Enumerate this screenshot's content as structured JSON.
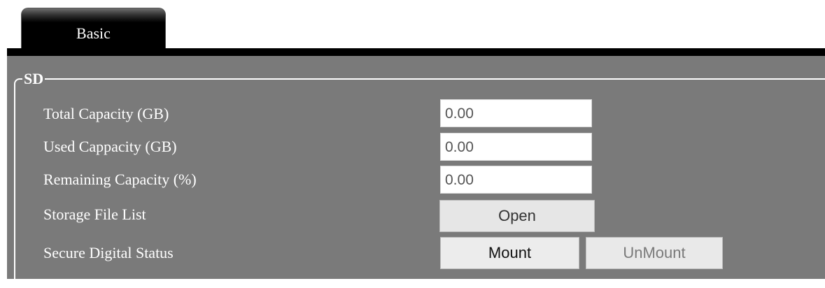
{
  "tabs": [
    {
      "label": "Basic",
      "active": true
    }
  ],
  "section": {
    "title": "SD"
  },
  "rows": [
    {
      "label": "Total Capacity (GB)",
      "value": "0.00"
    },
    {
      "label": "Used Cappacity (GB)",
      "value": "0.00"
    },
    {
      "label": "Remaining Capacity (%)",
      "value": "0.00"
    },
    {
      "label": "Storage File List"
    },
    {
      "label": "Secure Digital Status"
    }
  ],
  "buttons": {
    "open": "Open",
    "mount": "Mount",
    "unmount": "UnMount"
  },
  "colors": {
    "tab_bar": "#000000",
    "panel_background": "#7a7a7a",
    "text": "#ffffff",
    "button_background": "#e6e6e6",
    "disabled_text": "#7a7a7a"
  }
}
